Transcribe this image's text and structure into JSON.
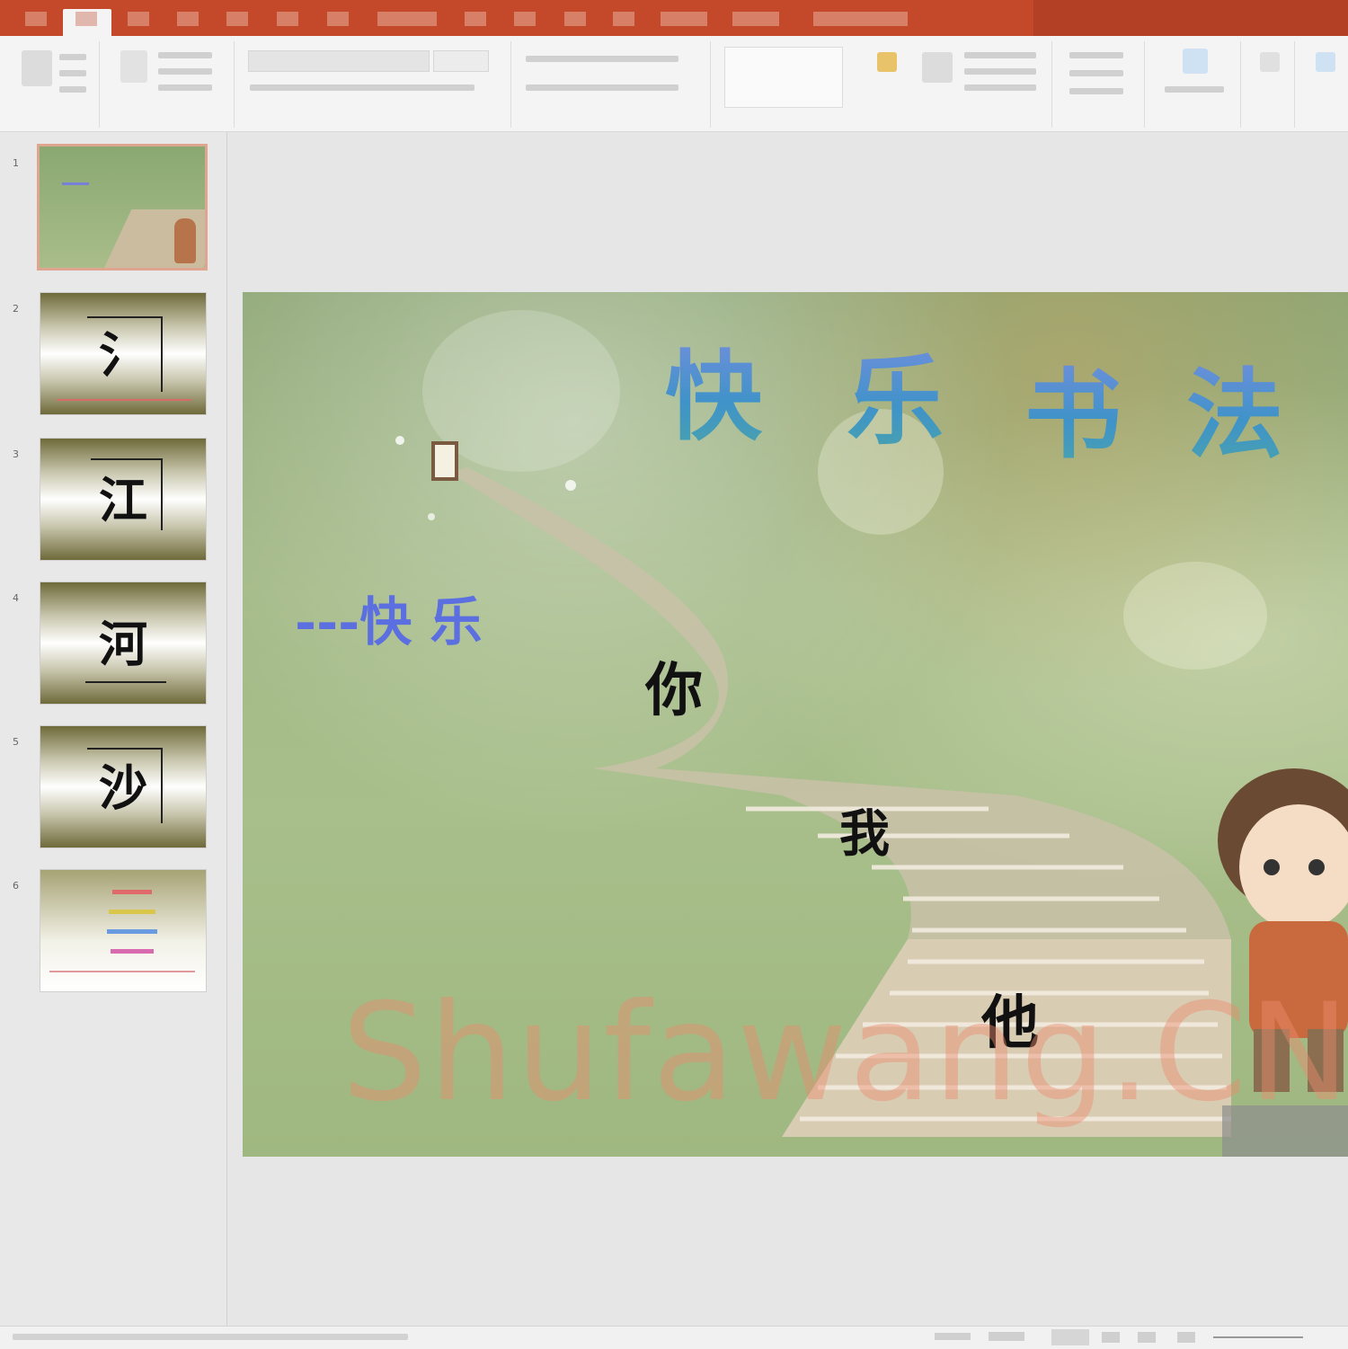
{
  "app": {
    "title": "",
    "accent_color": "#c4492a"
  },
  "tabs": [
    {
      "id": "file",
      "label": ""
    },
    {
      "id": "home",
      "label": ""
    },
    {
      "id": "insert",
      "label": ""
    },
    {
      "id": "design",
      "label": ""
    },
    {
      "id": "transitions",
      "label": ""
    },
    {
      "id": "animations",
      "label": ""
    },
    {
      "id": "slideshow",
      "label": ""
    },
    {
      "id": "review",
      "label": ""
    },
    {
      "id": "view",
      "label": ""
    },
    {
      "id": "help",
      "label": ""
    },
    {
      "id": "tellme",
      "label": ""
    }
  ],
  "ribbon": {
    "groups": [
      {
        "id": "clipboard",
        "label": ""
      },
      {
        "id": "slides",
        "label": ""
      },
      {
        "id": "font",
        "label": ""
      },
      {
        "id": "paragraph",
        "label": ""
      },
      {
        "id": "drawing",
        "label": ""
      },
      {
        "id": "editing",
        "label": ""
      },
      {
        "id": "voice",
        "label": ""
      }
    ]
  },
  "thumbnails": [
    {
      "number": "1",
      "char": "",
      "selected": true
    },
    {
      "number": "2",
      "char": "氵"
    },
    {
      "number": "3",
      "char": "江"
    },
    {
      "number": "4",
      "char": "河"
    },
    {
      "number": "5",
      "char": "沙"
    },
    {
      "number": "6",
      "char": ""
    }
  ],
  "slide": {
    "title_chars": [
      "快",
      "乐",
      "书",
      "法"
    ],
    "subtitle": "---快 乐",
    "stair_chars": [
      "你",
      "我",
      "他"
    ],
    "watermark": "Shufawang.CN"
  },
  "statusbar": {
    "left": "",
    "right": ""
  }
}
